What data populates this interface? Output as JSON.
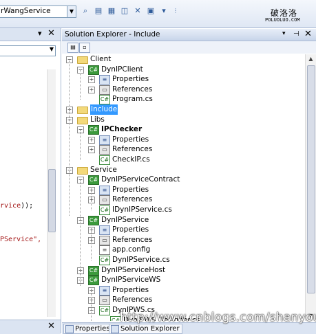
{
  "toolbar": {
    "solution_combo": "rWangService",
    "buttons": [
      "find-in-files-icon",
      "solution-explorer-icon",
      "properties-window-icon",
      "object-browser-icon",
      "toolbox-icon",
      "start-page-icon",
      "more-icon"
    ]
  },
  "logo": {
    "cn": "破洛洛",
    "en": "POLUOLUO.COM"
  },
  "editor": {
    "code_line1_a": "rvice",
    "code_line1_b": "));",
    "code_line2": "PService\","
  },
  "solution_explorer": {
    "title": "Solution Explorer - Include",
    "tree": [
      {
        "label": "Client",
        "icon": "folder",
        "level": 0,
        "expander": "minus"
      },
      {
        "label": "DynIPClient",
        "icon": "project",
        "level": 1,
        "expander": "minus"
      },
      {
        "label": "Properties",
        "icon": "properties",
        "level": 2,
        "expander": "plus"
      },
      {
        "label": "References",
        "icon": "references",
        "level": 2,
        "expander": "plus"
      },
      {
        "label": "Program.cs",
        "icon": "cs-file",
        "level": 2,
        "expander": "none"
      },
      {
        "label": "Include",
        "icon": "folder",
        "level": 0,
        "expander": "plus",
        "selected": true
      },
      {
        "label": "Libs",
        "icon": "folder",
        "level": 0,
        "expander": "minus"
      },
      {
        "label": "IPChecker",
        "icon": "project",
        "level": 1,
        "expander": "minus",
        "bold": true
      },
      {
        "label": "Properties",
        "icon": "properties",
        "level": 2,
        "expander": "plus"
      },
      {
        "label": "References",
        "icon": "references",
        "level": 2,
        "expander": "plus"
      },
      {
        "label": "CheckIP.cs",
        "icon": "cs-file",
        "level": 2,
        "expander": "none"
      },
      {
        "label": "Service",
        "icon": "folder",
        "level": 0,
        "expander": "minus"
      },
      {
        "label": "DynIPServiceContract",
        "icon": "project",
        "level": 1,
        "expander": "minus"
      },
      {
        "label": "Properties",
        "icon": "properties",
        "level": 2,
        "expander": "plus"
      },
      {
        "label": "References",
        "icon": "references",
        "level": 2,
        "expander": "plus"
      },
      {
        "label": "IDynIPService.cs",
        "icon": "cs-file",
        "level": 2,
        "expander": "none"
      },
      {
        "label": "DynIPService",
        "icon": "project",
        "level": 1,
        "expander": "minus"
      },
      {
        "label": "Properties",
        "icon": "properties",
        "level": 2,
        "expander": "plus"
      },
      {
        "label": "References",
        "icon": "references",
        "level": 2,
        "expander": "plus"
      },
      {
        "label": "app.config",
        "icon": "config-file",
        "level": 2,
        "expander": "none"
      },
      {
        "label": "DynIPService.cs",
        "icon": "cs-file",
        "level": 2,
        "expander": "none"
      },
      {
        "label": "DynIPServiceHost",
        "icon": "project",
        "level": 1,
        "expander": "plus"
      },
      {
        "label": "DynIPServiceWS",
        "icon": "project",
        "level": 1,
        "expander": "minus"
      },
      {
        "label": "Properties",
        "icon": "properties",
        "level": 2,
        "expander": "plus"
      },
      {
        "label": "References",
        "icon": "references",
        "level": 2,
        "expander": "plus"
      },
      {
        "label": "DynIPWS.cs",
        "icon": "cs-file",
        "level": 2,
        "expander": "minus"
      },
      {
        "label": "DynIPWS.Designer.cs",
        "icon": "cs-file",
        "level": 3,
        "expander": "none"
      }
    ],
    "tabs": [
      "Properties",
      "Solution Explorer"
    ]
  },
  "watermark": "http://www.cnblogs.com/shanyou"
}
